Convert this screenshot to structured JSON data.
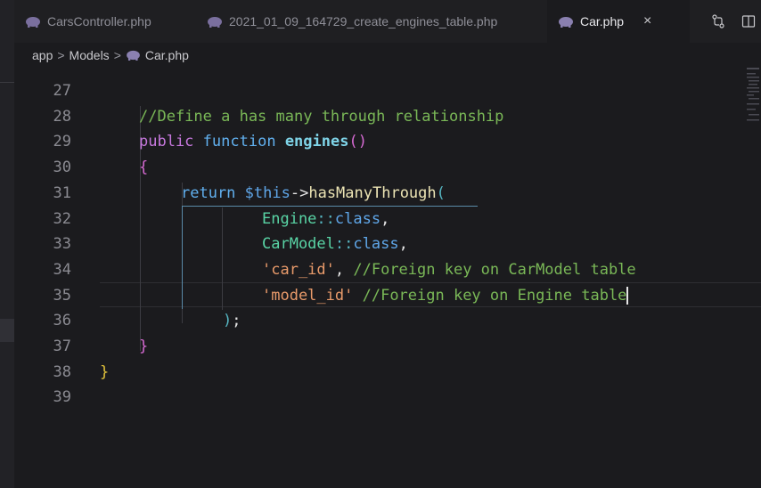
{
  "tabs": [
    {
      "label": "CarsController.php",
      "active": false,
      "icon": "elephant-icon"
    },
    {
      "label": "2021_01_09_164729_create_engines_table.php",
      "active": false,
      "icon": "elephant-icon"
    },
    {
      "label": "Car.php",
      "active": true,
      "icon": "elephant-icon",
      "close": "×"
    }
  ],
  "breadcrumb": [
    "app",
    "Models",
    "Car.php"
  ],
  "breadcrumb_sep": ">",
  "editor": {
    "lines": [
      {
        "num": "27",
        "tokens": []
      },
      {
        "num": "28",
        "tokens": [
          {
            "t": "//Define a has many through relationship",
            "c": "c-comment"
          }
        ]
      },
      {
        "num": "29",
        "tokens": [
          {
            "t": "public",
            "c": "c-kw"
          },
          {
            "t": " ",
            "c": ""
          },
          {
            "t": "function",
            "c": "c-fn"
          },
          {
            "t": " ",
            "c": ""
          },
          {
            "t": "engines",
            "c": "c-def"
          },
          {
            "t": "()",
            "c": "c-paren"
          }
        ]
      },
      {
        "num": "30",
        "tokens": [
          {
            "t": "{",
            "c": "c-brace2"
          }
        ]
      },
      {
        "num": "31",
        "tokens": [
          {
            "t": "return",
            "c": "c-fn"
          },
          {
            "t": " ",
            "c": ""
          },
          {
            "t": "$this",
            "c": "c-this"
          },
          {
            "t": "->",
            "c": "c-white"
          },
          {
            "t": "hasManyThrough",
            "c": "c-method"
          },
          {
            "t": "(",
            "c": "c-op"
          }
        ]
      },
      {
        "num": "32",
        "tokens": [
          {
            "t": "Engine",
            "c": "c-class"
          },
          {
            "t": "::",
            "c": "c-op"
          },
          {
            "t": "class",
            "c": "c-blue"
          },
          {
            "t": ",",
            "c": "c-white"
          }
        ]
      },
      {
        "num": "33",
        "tokens": [
          {
            "t": "CarModel",
            "c": "c-class"
          },
          {
            "t": "::",
            "c": "c-op"
          },
          {
            "t": "class",
            "c": "c-blue"
          },
          {
            "t": ",",
            "c": "c-white"
          }
        ]
      },
      {
        "num": "34",
        "tokens": [
          {
            "t": "'car_id'",
            "c": "c-str"
          },
          {
            "t": ", ",
            "c": "c-white"
          },
          {
            "t": "//Foreign key on CarModel table",
            "c": "c-comment"
          }
        ]
      },
      {
        "num": "35",
        "tokens": [
          {
            "t": "'model_id'",
            "c": "c-str"
          },
          {
            "t": " ",
            "c": ""
          },
          {
            "t": "//Foreign key on Engine table",
            "c": "c-comment"
          }
        ]
      },
      {
        "num": "36",
        "tokens": [
          {
            "t": ")",
            "c": "c-op"
          },
          {
            "t": ";",
            "c": "c-white"
          }
        ]
      },
      {
        "num": "37",
        "tokens": [
          {
            "t": "}",
            "c": "c-brace2"
          }
        ]
      },
      {
        "num": "38",
        "tokens": [
          {
            "t": "}",
            "c": "c-brace"
          }
        ]
      },
      {
        "num": "39",
        "tokens": []
      }
    ]
  },
  "colors": {
    "background": "#1b1b1e",
    "comment": "#7ab857",
    "keyword": "#c678dd",
    "string": "#e89a6a",
    "class": "#59d4a5"
  }
}
